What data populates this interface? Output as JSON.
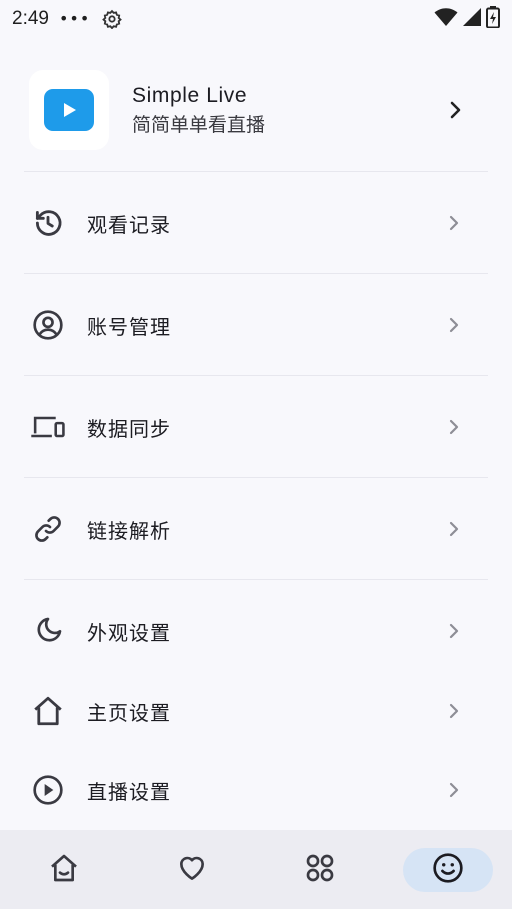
{
  "status_bar": {
    "time": "2:49",
    "dots": "•••"
  },
  "app": {
    "name": "Simple Live",
    "subtitle": "简简单单看直播",
    "logo_color": "#1e9bea"
  },
  "menu": [
    {
      "label": "观看记录",
      "icon": "history-icon"
    },
    {
      "label": "账号管理",
      "icon": "account-circle-icon"
    },
    {
      "label": "数据同步",
      "icon": "devices-icon"
    },
    {
      "label": "链接解析",
      "icon": "link-icon"
    },
    {
      "label": "外观设置",
      "icon": "moon-icon"
    },
    {
      "label": "主页设置",
      "icon": "home-icon"
    },
    {
      "label": "直播设置",
      "icon": "play-circle-icon"
    }
  ],
  "bottom_nav": {
    "items": [
      {
        "icon": "home-icon",
        "active": false
      },
      {
        "icon": "heart-icon",
        "active": false
      },
      {
        "icon": "category-icon",
        "active": false
      },
      {
        "icon": "smile-icon",
        "active": true
      }
    ],
    "active_color": "#d6e4f5"
  }
}
